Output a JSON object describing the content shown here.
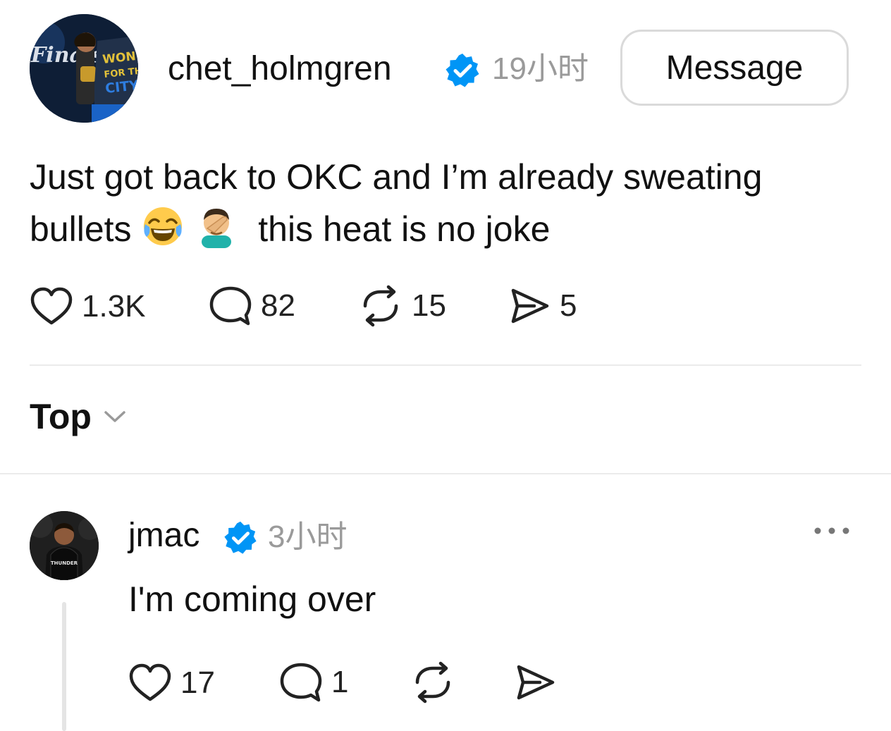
{
  "post": {
    "username": "chet_holmgren",
    "time": "19小时",
    "message_label": "Message",
    "text_before_emoji": "Just got back to OKC and I’m already sweating bullets",
    "emojis": [
      "face-with-tears-of-joy",
      "man-facepalming"
    ],
    "text_after_emoji": "this heat is no joke",
    "avatar_text": {
      "brand": "Finals",
      "shirt": "WON FOR THE CITY"
    },
    "actions": {
      "likes": "1.3K",
      "comments": "82",
      "reposts": "15",
      "shares": "5"
    }
  },
  "sort": {
    "label": "Top",
    "icon": "chevron-down-icon"
  },
  "reply": {
    "username": "jmac",
    "time": "3小时",
    "text": "I'm coming over",
    "avatar_text": {
      "shirt": "THUNDER"
    },
    "actions": {
      "likes": "17",
      "comments": "1"
    }
  },
  "colors": {
    "verified_blue": "#0095f6",
    "muted_text": "#9a9a9a",
    "divider": "#ebebeb"
  }
}
